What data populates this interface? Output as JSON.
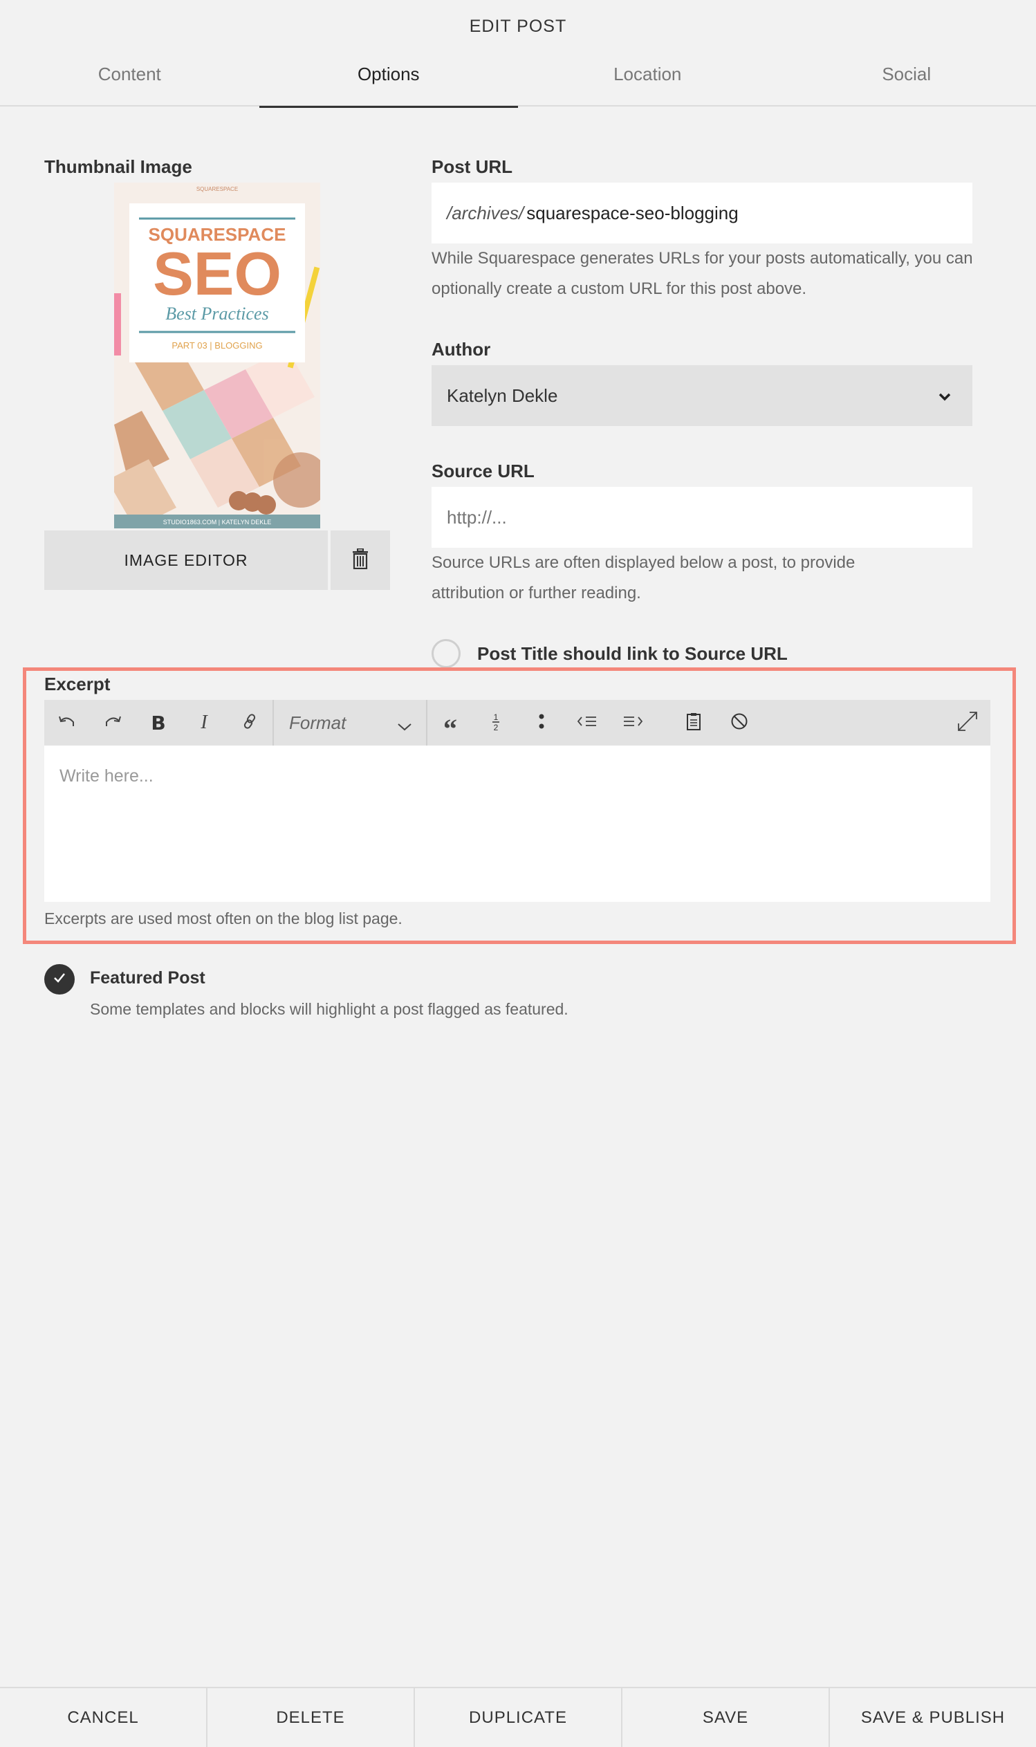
{
  "dialog": {
    "title": "EDIT POST"
  },
  "tabs": [
    {
      "label": "Content"
    },
    {
      "label": "Options"
    },
    {
      "label": "Location"
    },
    {
      "label": "Social"
    }
  ],
  "thumbnail": {
    "label": "Thumbnail Image",
    "image_text": {
      "brand_top": "SQUARESPACE",
      "line1": "SQUARESPACE",
      "line2": "SEO",
      "line3": "Best Practices",
      "line4": "PART 03 | BLOGGING",
      "footer": "STUDIO1863.COM | KATELYN DEKLE"
    },
    "image_editor_label": "IMAGE EDITOR"
  },
  "post_url": {
    "label": "Post URL",
    "prefix": "/archives/",
    "value": "squarespace-seo-blogging",
    "help": "While Squarespace generates URLs for your posts automatically, you can optionally create a custom URL for this post above."
  },
  "author": {
    "label": "Author",
    "selected": "Katelyn Dekle"
  },
  "source_url": {
    "label": "Source URL",
    "placeholder": "http://...",
    "help": "Source URLs are often displayed below a post, to provide attribution or further reading.",
    "link_toggle_label": "Post Title should link to Source URL"
  },
  "excerpt": {
    "label": "Excerpt",
    "format_label": "Format",
    "placeholder": "Write here...",
    "help": "Excerpts are used most often on the blog list page."
  },
  "featured": {
    "label": "Featured Post",
    "help": "Some templates and blocks will highlight a post flagged as featured."
  },
  "footer": {
    "cancel": "CANCEL",
    "delete": "DELETE",
    "duplicate": "DUPLICATE",
    "save": "SAVE",
    "save_publish": "SAVE & PUBLISH"
  },
  "colors": {
    "highlight_border": "#f4877b",
    "accent_orange": "#e08a5c",
    "accent_teal": "#5b9aa6"
  }
}
